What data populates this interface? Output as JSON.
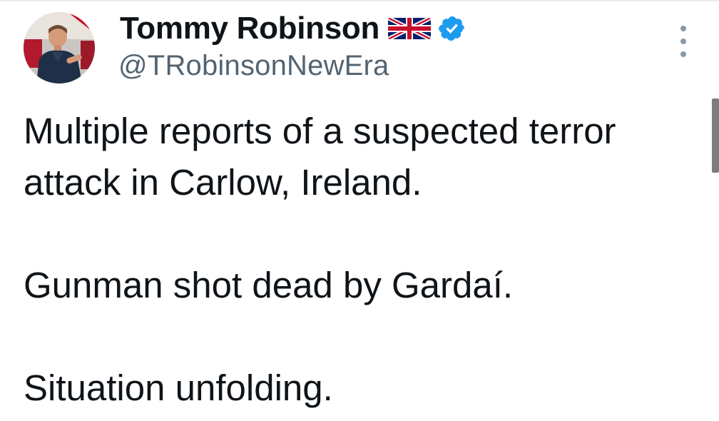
{
  "author": {
    "display_name": "Tommy Robinson",
    "handle": "@TRobinsonNewEra",
    "flag_icon": "uk-flag-icon",
    "verified_icon": "verified-badge-icon",
    "verified_color": "#1d9bf0",
    "avatar_icon": "profile-photo"
  },
  "menu": {
    "icon": "more-vertical-icon"
  },
  "tweet": {
    "paragraphs": [
      "Multiple reports of a suspected terror attack in Carlow, Ireland.",
      "Gunman shot dead by Gardaí.",
      "Situation unfolding."
    ]
  },
  "colors": {
    "text": "#0f1419",
    "secondary_text": "#536471",
    "scrollbar": "#7c7c7c"
  }
}
